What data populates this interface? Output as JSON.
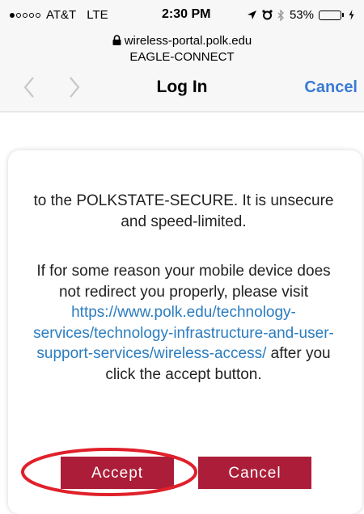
{
  "status_bar": {
    "signal_bars_filled": 1,
    "signal_bars_total": 5,
    "carrier": "AT&T",
    "network": "LTE",
    "time": "2:30 PM",
    "battery_percent": "53%",
    "battery_level": 0.53,
    "icons": [
      "location-arrow-icon",
      "alarm-clock-icon",
      "bluetooth-icon",
      "battery-icon",
      "charging-icon"
    ]
  },
  "browser": {
    "url": "wireless-portal.polk.edu",
    "site_name": "EAGLE-CONNECT",
    "title": "Log In",
    "cancel_label": "Cancel"
  },
  "content": {
    "paragraph1": "to the POLKSTATE-SECURE. It is unsecure and speed-limited.",
    "paragraph2_before": "If for some reason your mobile device does not redirect you properly, please visit ",
    "link_text": "https://www.polk.edu/technology-services/technology-infrastructure-and-user-support-services/wireless-access/",
    "paragraph2_after": " after you click the accept button."
  },
  "buttons": {
    "accept_label": "Accept",
    "cancel_label": "Cancel"
  },
  "colors": {
    "link": "#2b7dc0",
    "nav_accent": "#3a7bd5",
    "button": "#ab1d38",
    "highlight_ring": "#e0202a",
    "battery_fill": "#4cd964"
  }
}
